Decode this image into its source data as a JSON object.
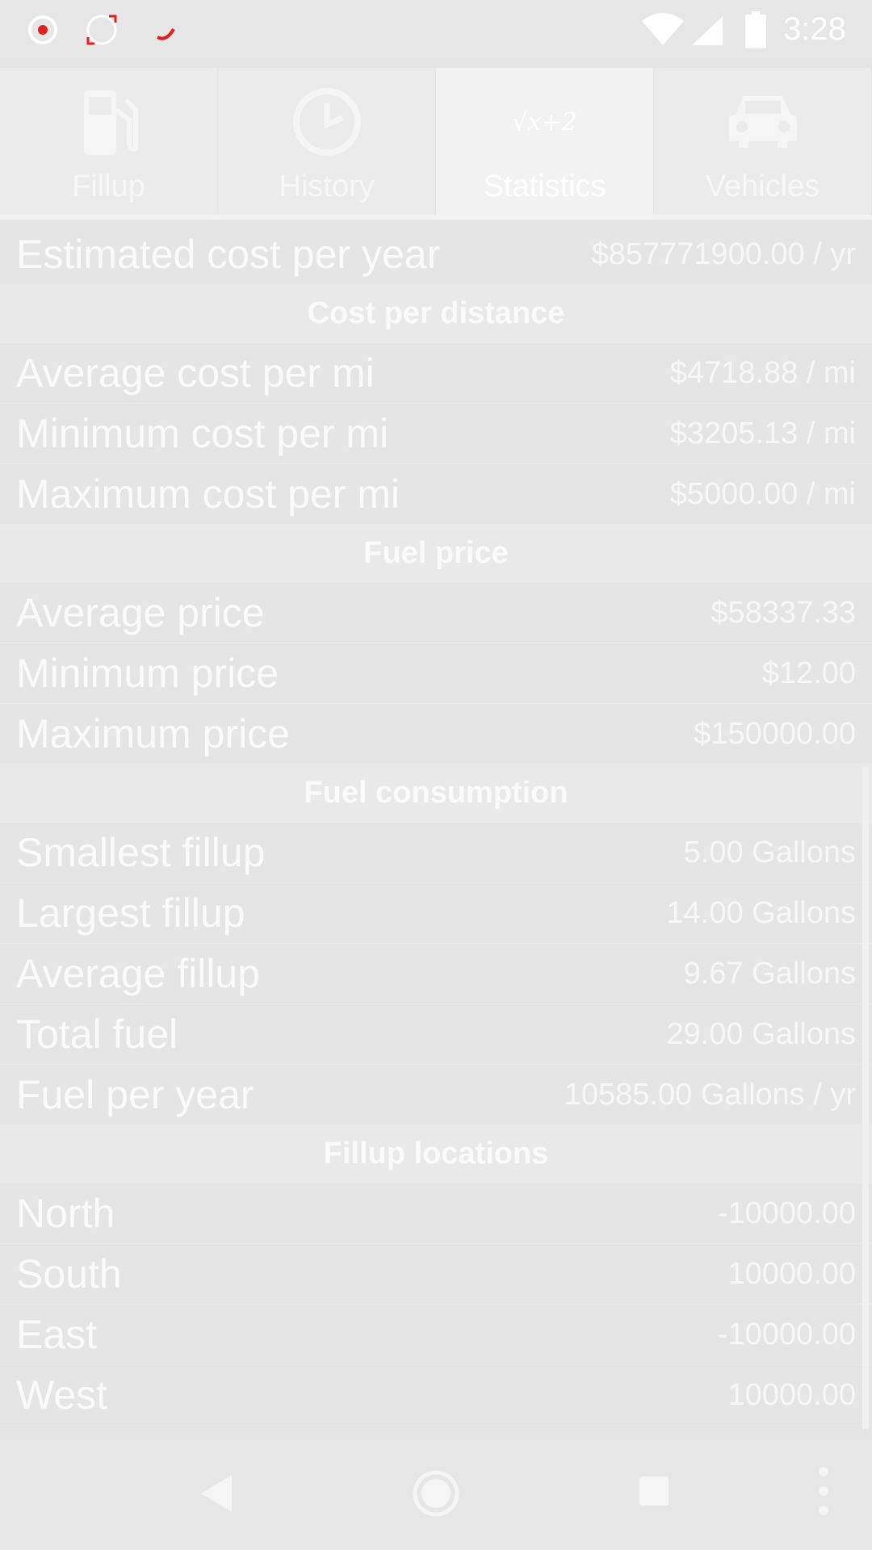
{
  "status_bar": {
    "time": "3:28",
    "icons": [
      "notification-icon",
      "notification-icon",
      "notification-icon",
      "wifi-icon",
      "cell-signal-icon",
      "battery-icon"
    ]
  },
  "tabs": [
    {
      "label": "Fillup",
      "icon": "fuel-pump-icon",
      "active": false
    },
    {
      "label": "History",
      "icon": "clock-icon",
      "active": false
    },
    {
      "label": "Statistics",
      "icon": "sqrt-formula-icon",
      "active": true,
      "icon_text": "√x+2"
    },
    {
      "label": "Vehicles",
      "icon": "car-icon",
      "active": false
    }
  ],
  "stats": {
    "estimated_cost": {
      "label": "Estimated cost per year",
      "value": "$857771900.00 / yr"
    },
    "cost_per_distance": {
      "header": "Cost per distance",
      "rows": [
        {
          "label": "Average cost per mi",
          "value": "$4718.88 / mi"
        },
        {
          "label": "Minimum cost per mi",
          "value": "$3205.13 / mi"
        },
        {
          "label": "Maximum cost per mi",
          "value": "$5000.00 / mi"
        }
      ]
    },
    "fuel_price": {
      "header": "Fuel price",
      "rows": [
        {
          "label": "Average price",
          "value": "$58337.33"
        },
        {
          "label": "Minimum price",
          "value": "$12.00"
        },
        {
          "label": "Maximum price",
          "value": "$150000.00"
        }
      ]
    },
    "fuel_consumption": {
      "header": "Fuel consumption",
      "rows": [
        {
          "label": "Smallest fillup",
          "value": "5.00 Gallons"
        },
        {
          "label": "Largest fillup",
          "value": "14.00 Gallons"
        },
        {
          "label": "Average fillup",
          "value": "9.67 Gallons"
        },
        {
          "label": "Total fuel",
          "value": "29.00 Gallons"
        },
        {
          "label": "Fuel per year",
          "value": "10585.00 Gallons / yr"
        }
      ]
    },
    "fillup_locations": {
      "header": "Fillup locations",
      "rows": [
        {
          "label": "North",
          "value": "-10000.00"
        },
        {
          "label": "South",
          "value": "10000.00"
        },
        {
          "label": "East",
          "value": "-10000.00"
        },
        {
          "label": "West",
          "value": "10000.00"
        }
      ]
    }
  },
  "navbar": {
    "buttons": [
      "back-icon",
      "home-icon",
      "recents-icon",
      "overflow-menu-icon"
    ]
  }
}
